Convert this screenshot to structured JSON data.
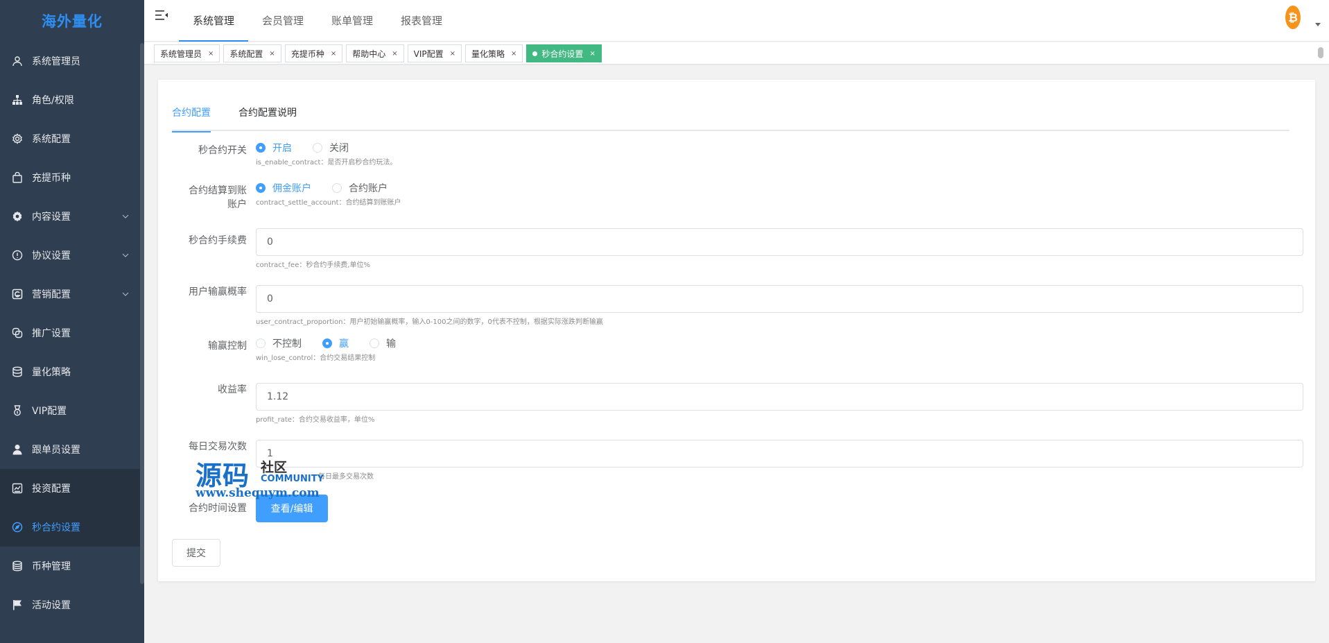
{
  "app": {
    "title": "海外量化"
  },
  "sidebar": {
    "items": [
      {
        "label": "系统管理员",
        "icon": "user-icon"
      },
      {
        "label": "角色/权限",
        "icon": "sitemap-icon"
      },
      {
        "label": "系统配置",
        "icon": "gear-icon"
      },
      {
        "label": "充提币种",
        "icon": "bag-icon"
      },
      {
        "label": "内容设置",
        "icon": "settings-icon"
      },
      {
        "label": "协议设置",
        "icon": "info-icon"
      },
      {
        "label": "营销配置",
        "icon": "marketing-icon"
      },
      {
        "label": "推广设置",
        "icon": "link-icon"
      },
      {
        "label": "量化策略",
        "icon": "database-icon"
      },
      {
        "label": "VIP配置",
        "icon": "medal-icon"
      },
      {
        "label": "跟单员设置",
        "icon": "person-icon"
      },
      {
        "label": "投资配置",
        "icon": "chart-icon"
      },
      {
        "label": "秒合约设置",
        "icon": "compass-icon"
      },
      {
        "label": "币种管理",
        "icon": "coins-icon"
      },
      {
        "label": "活动设置",
        "icon": "flag-icon"
      }
    ]
  },
  "header": {
    "tabs": [
      "系统管理",
      "会员管理",
      "账单管理",
      "报表管理"
    ],
    "active_tab": "系统管理"
  },
  "tagbar": {
    "tags": [
      "系统管理员",
      "系统配置",
      "充提币种",
      "帮助中心",
      "VIP配置",
      "量化策略",
      "秒合约设置"
    ],
    "active_tag": "秒合约设置",
    "close_glyph": "×"
  },
  "content": {
    "tabs": [
      "合约配置",
      "合约配置说明"
    ],
    "active_tab": "合约配置",
    "fields": {
      "enable": {
        "label": "秒合约开关",
        "options": [
          "开启",
          "关闭"
        ],
        "selected": "开启",
        "hint": "is_enable_contract：是否开启秒合约玩法。"
      },
      "settle": {
        "label_line1": "合约结算到账",
        "label_line2": "账户",
        "options": [
          "佣金账户",
          "合约账户"
        ],
        "selected": "佣金账户",
        "hint": "contract_settle_account：合约结算到账账户"
      },
      "fee": {
        "label": "秒合约手续费",
        "value": "0",
        "hint": "contract_fee：秒合约手续费,单位%"
      },
      "proportion": {
        "label": "用户输赢概率",
        "value": "0",
        "hint": "user_contract_proportion：用户初始输赢概率，输入0-100之间的数字，0代表不控制，根据实际涨跌判断输赢"
      },
      "control": {
        "label": "输赢控制",
        "options": [
          "不控制",
          "赢",
          "输"
        ],
        "selected": "赢",
        "hint": "win_lose_control：合约交易结果控制"
      },
      "profit": {
        "label": "收益率",
        "value": "1.12",
        "hint": "profit_rate：合约交易收益率，单位%"
      },
      "daily": {
        "label": "每日交易次数",
        "value": "1",
        "hint": "每日最多交易次数"
      },
      "time": {
        "label": "合约时间设置",
        "button": "查看/编辑"
      }
    },
    "submit_label": "提交"
  },
  "watermark": {
    "big": "源码",
    "small1": "社区",
    "small2": "COMMUNITY",
    "url": "www.shequym.com"
  },
  "colors": {
    "sidebar_bg": "#2f3e50",
    "accent": "#409eff",
    "active_tag": "#42b983",
    "bitcoin": "#f7931a"
  }
}
